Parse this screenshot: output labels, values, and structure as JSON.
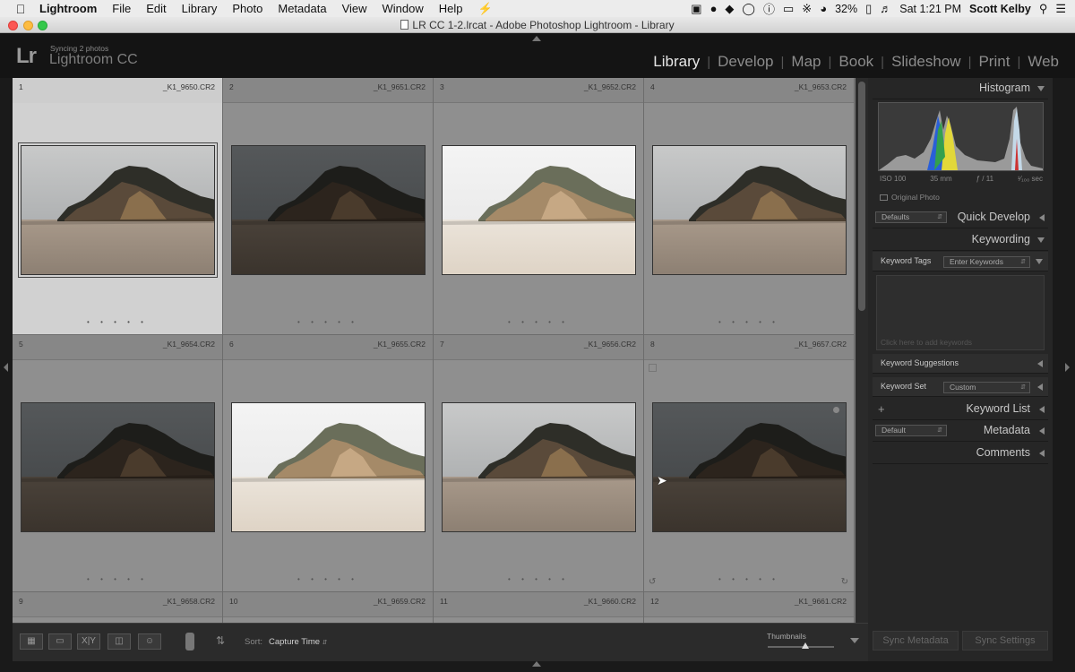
{
  "menubar": {
    "app_name": "Lightroom",
    "menus": [
      "File",
      "Edit",
      "Library",
      "Photo",
      "Metadata",
      "View",
      "Window",
      "Help"
    ],
    "battery": "32%",
    "time": "Sat 1:21 PM",
    "user": "Scott Kelby"
  },
  "window": {
    "title": "LR CC 1-2.lrcat - Adobe Photoshop Lightroom - Library"
  },
  "identity": {
    "logo": "Lr",
    "sync_status": "Syncing 2 photos",
    "product": "Lightroom CC"
  },
  "modules": [
    "Library",
    "Develop",
    "Map",
    "Book",
    "Slideshow",
    "Print",
    "Web"
  ],
  "active_module": "Library",
  "grid": {
    "cells": [
      {
        "num": "1",
        "file": "_K1_9650.CR2",
        "selected": true,
        "tone": "normal"
      },
      {
        "num": "2",
        "file": "_K1_9651.CR2",
        "selected": false,
        "tone": "dark"
      },
      {
        "num": "3",
        "file": "_K1_9652.CR2",
        "selected": false,
        "tone": "bright"
      },
      {
        "num": "4",
        "file": "_K1_9653.CR2",
        "selected": false,
        "tone": "normal"
      },
      {
        "num": "5",
        "file": "_K1_9654.CR2",
        "selected": false,
        "tone": "dark"
      },
      {
        "num": "6",
        "file": "_K1_9655.CR2",
        "selected": false,
        "tone": "bright"
      },
      {
        "num": "7",
        "file": "_K1_9656.CR2",
        "selected": false,
        "tone": "normal"
      },
      {
        "num": "8",
        "file": "_K1_9657.CR2",
        "selected": false,
        "tone": "dark"
      },
      {
        "num": "9",
        "file": "_K1_9658.CR2"
      },
      {
        "num": "10",
        "file": "_K1_9659.CR2"
      },
      {
        "num": "11",
        "file": "_K1_9660.CR2"
      },
      {
        "num": "12",
        "file": "_K1_9661.CR2"
      }
    ],
    "rating_dots": "• • • • •"
  },
  "toolbar": {
    "sort_label": "Sort:",
    "sort_value": "Capture Time",
    "thumbnails_label": "Thumbnails",
    "view_buttons": [
      "grid-view",
      "loupe-view",
      "compare-view",
      "survey-view",
      "people-view"
    ],
    "compare_label": "X|Y"
  },
  "right_panel": {
    "histogram": {
      "title": "Histogram",
      "iso": "ISO 100",
      "focal": "35 mm",
      "aperture": "ƒ / 11",
      "shutter": "¹⁄₁₀₀ sec",
      "original_photo": "Original Photo"
    },
    "quick_develop": {
      "title": "Quick Develop",
      "preset": "Defaults"
    },
    "keywording": {
      "title": "Keywording",
      "tags_label": "Keyword Tags",
      "tags_value": "Enter Keywords",
      "placeholder": "Click here to add keywords",
      "suggestions": "Keyword Suggestions",
      "set_label": "Keyword Set",
      "set_value": "Custom"
    },
    "keyword_list": {
      "title": "Keyword List"
    },
    "metadata": {
      "title": "Metadata",
      "preset": "Default"
    },
    "comments": {
      "title": "Comments"
    },
    "sync_metadata": "Sync Metadata",
    "sync_settings": "Sync Settings"
  },
  "colors": {
    "panel_bg": "#262626",
    "grid_bg": "#8f8f8f",
    "selected_cell": "#d1d1d1",
    "active_module": "#e6e6e6"
  }
}
